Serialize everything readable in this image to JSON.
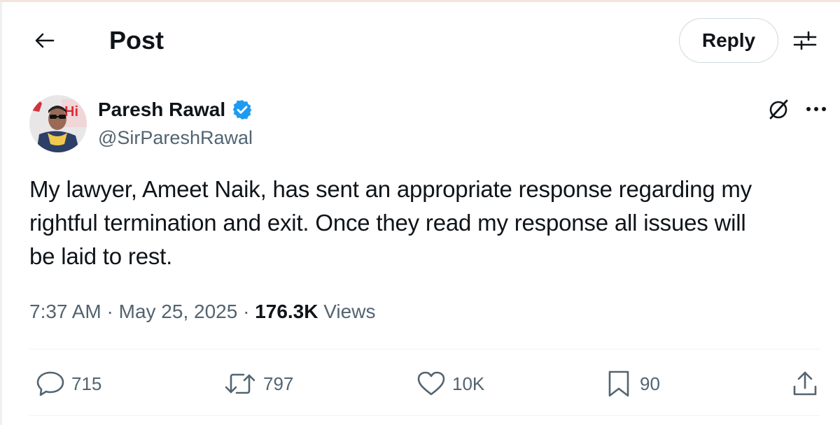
{
  "header": {
    "title": "Post",
    "reply_label": "Reply"
  },
  "author": {
    "display_name": "Paresh Rawal",
    "handle": "@SirPareshRawal",
    "verified": true
  },
  "tweet": {
    "lines": [
      "My lawyer, Ameet Naik, has sent an appropriate response regarding my",
      "rightful termination and exit. Once they read my response all issues will",
      "be laid to rest."
    ]
  },
  "meta": {
    "time": "7:37 AM",
    "separator": " · ",
    "date": "May 25, 2025",
    "views_count": "176.3K",
    "views_label": "Views"
  },
  "actions": {
    "replies": "715",
    "reposts": "797",
    "likes": "10K",
    "bookmarks": "90"
  },
  "icons": {
    "back": "arrow-left-icon",
    "filter": "sliders-icon",
    "verified": "verified-badge-icon",
    "grok": "grok-icon",
    "more": "more-horizontal-icon",
    "reply": "reply-icon",
    "repost": "repost-icon",
    "like": "heart-icon",
    "bookmark": "bookmark-icon",
    "share": "share-icon"
  },
  "colors": {
    "text": "#0f1419",
    "secondary": "#536471",
    "verified": "#1d9bf0",
    "border": "#cfd9de"
  }
}
